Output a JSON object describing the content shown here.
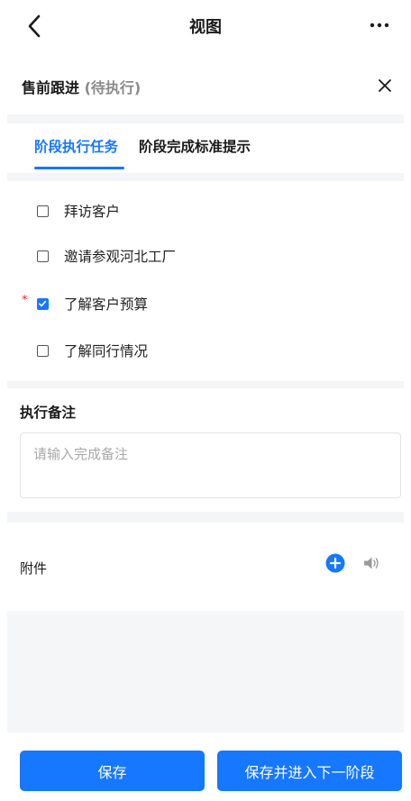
{
  "navbar": {
    "title": "视图",
    "back_icon": "chevron-left-icon",
    "more_icon": "more-dots-icon"
  },
  "stage": {
    "name": "售前跟进",
    "status": "(待执行)",
    "close_icon": "close-icon"
  },
  "tabs": [
    {
      "label": "阶段执行任务",
      "active": true
    },
    {
      "label": "阶段完成标准提示",
      "active": false
    }
  ],
  "tasks": [
    {
      "label": "拜访客户",
      "checked": false,
      "required": false
    },
    {
      "label": "邀请参观河北工厂",
      "checked": false,
      "required": false
    },
    {
      "label": "了解客户预算",
      "checked": true,
      "required": true
    },
    {
      "label": "了解同行情况",
      "checked": false,
      "required": false
    }
  ],
  "required_marker": "*",
  "remark": {
    "title": "执行备注",
    "placeholder": "请输入完成备注",
    "value": ""
  },
  "attachments": {
    "label": "附件",
    "add_icon": "add-circle-icon",
    "voice_icon": "speaker-icon"
  },
  "buttons": {
    "save": "保存",
    "save_next": "保存并进入下一阶段"
  },
  "colors": {
    "accent": "#1677ff",
    "required": "#f5222d",
    "band": "#f4f5f7"
  }
}
